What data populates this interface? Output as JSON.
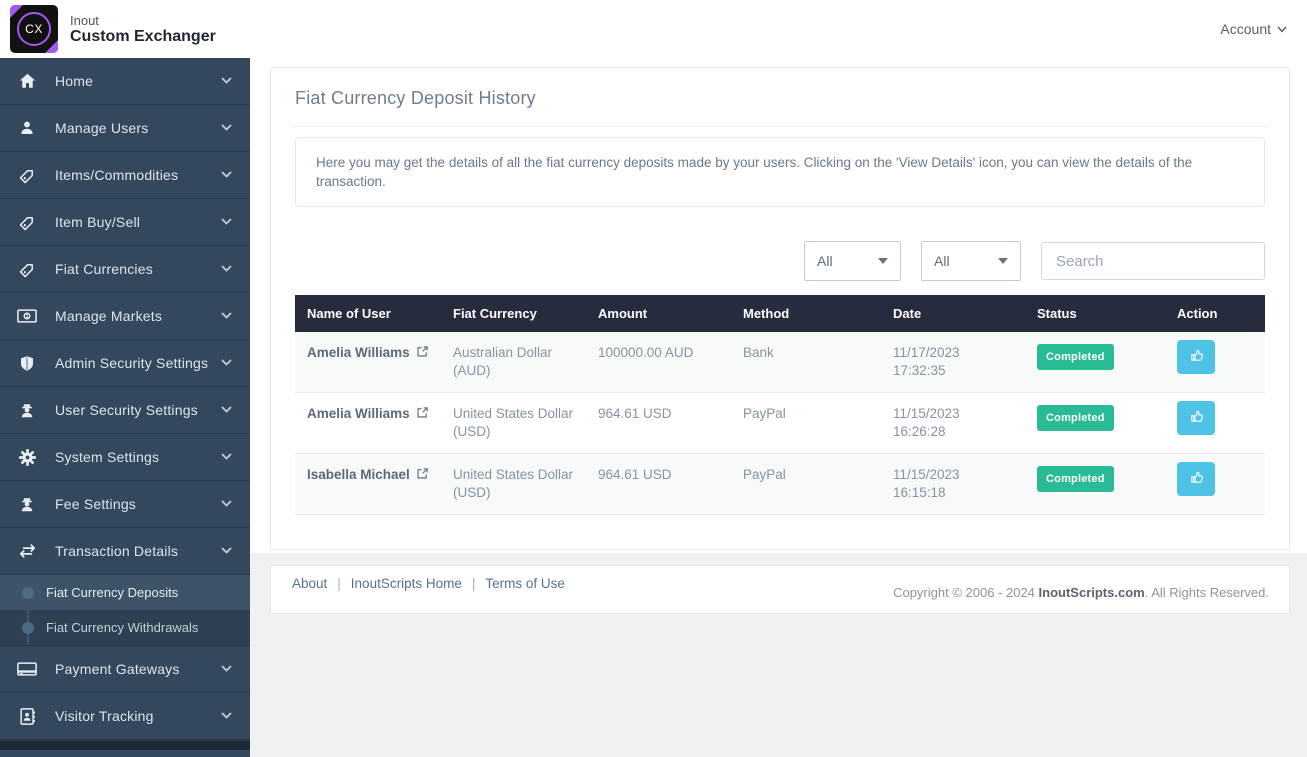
{
  "brand": {
    "logo_text": "CX",
    "line1": "Inout",
    "line2": "Custom Exchanger"
  },
  "navbar": {
    "account_label": "Account"
  },
  "colors": {
    "brand_purple": "#a558f0",
    "status_green": "#29bb96",
    "action_blue": "#4ec3e5",
    "sidebar_bg": "#33485c",
    "table_header_bg": "#262b3e"
  },
  "sidebar": {
    "items": [
      {
        "label": "Home",
        "icon": "home-icon"
      },
      {
        "label": "Manage Users",
        "icon": "user-icon"
      },
      {
        "label": "Items/Commodities",
        "icon": "tags-icon"
      },
      {
        "label": "Item Buy/Sell",
        "icon": "tags-icon"
      },
      {
        "label": "Fiat Currencies",
        "icon": "tags-icon"
      },
      {
        "label": "Manage Markets",
        "icon": "money-icon"
      },
      {
        "label": "Admin Security Settings",
        "icon": "shield-icon"
      },
      {
        "label": "User Security Settings",
        "icon": "user-secret-icon"
      },
      {
        "label": "System Settings",
        "icon": "gear-icon"
      },
      {
        "label": "Fee Settings",
        "icon": "user-secret-icon"
      },
      {
        "label": "Transaction Details",
        "icon": "exchange-icon",
        "expanded": true,
        "children": [
          {
            "label": "Fiat Currency Deposits",
            "active": true
          },
          {
            "label": "Fiat Currency Withdrawals",
            "active": false
          }
        ]
      },
      {
        "label": "Payment Gateways",
        "icon": "credit-card-icon"
      },
      {
        "label": "Visitor Tracking",
        "icon": "address-book-icon"
      }
    ]
  },
  "page": {
    "title": "Fiat Currency Deposit History",
    "description": "Here you may get the details of all the fiat currency deposits made by your users. Clicking on the 'View Details' icon, you can view the details of the transaction."
  },
  "filters": {
    "filter1_value": "All",
    "filter2_value": "All",
    "search_placeholder": "Search"
  },
  "table": {
    "columns": [
      "Name of User",
      "Fiat Currency",
      "Amount",
      "Method",
      "Date",
      "Status",
      "Action"
    ],
    "rows": [
      {
        "name": "Amelia Williams",
        "currency": "Australian Dollar (AUD)",
        "amount": "100000.00 AUD",
        "method": "Bank",
        "date": "11/17/2023 17:32:35",
        "status": "Completed"
      },
      {
        "name": "Amelia Williams",
        "currency": "United States Dollar (USD)",
        "amount": "964.61 USD",
        "method": "PayPal",
        "date": "11/15/2023 16:26:28",
        "status": "Completed"
      },
      {
        "name": "Isabella Michael",
        "currency": "United States Dollar (USD)",
        "amount": "964.61 USD",
        "method": "PayPal",
        "date": "11/15/2023 16:15:18",
        "status": "Completed"
      }
    ]
  },
  "footer": {
    "links": [
      "About",
      "InoutScripts Home",
      "Terms of Use"
    ],
    "copyright_prefix": "Copyright © 2006 - 2024 ",
    "copyright_brand": "InoutScripts.com",
    "copyright_suffix": ". All Rights Reserved."
  }
}
